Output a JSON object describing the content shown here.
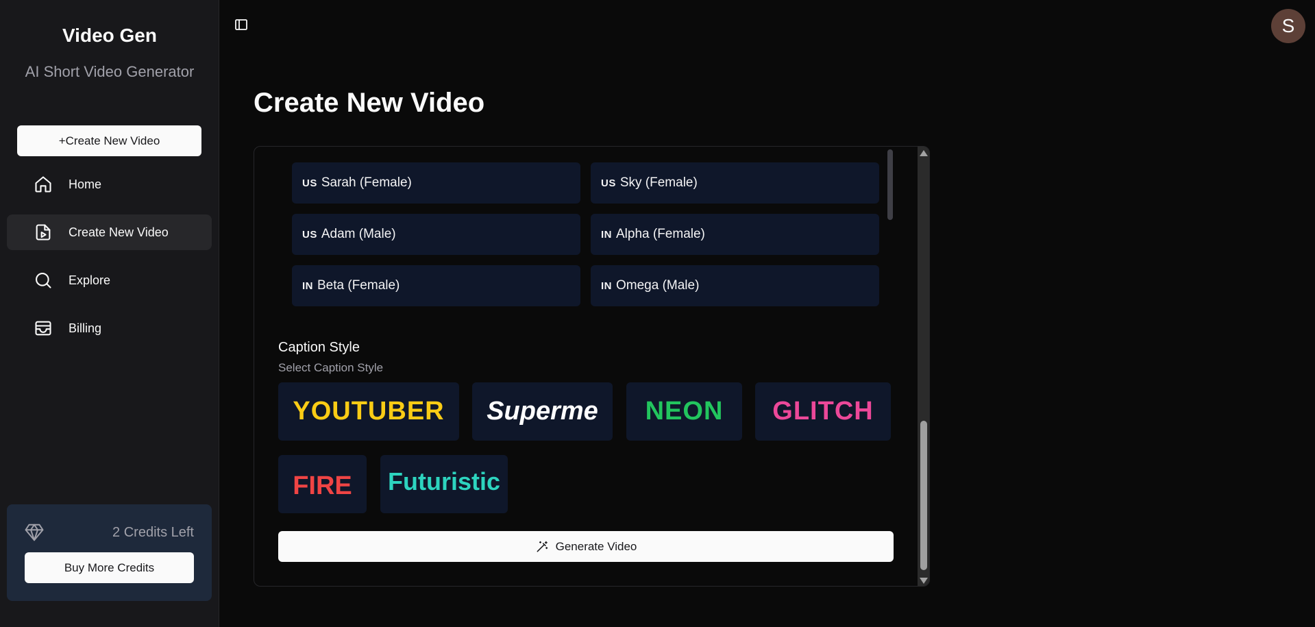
{
  "sidebar": {
    "brand_title": "Video Gen",
    "brand_subtitle": "AI Short Video Generator",
    "create_button": "+Create New Video",
    "items": [
      {
        "label": "Home",
        "icon": "home-icon",
        "active": false
      },
      {
        "label": "Create New Video",
        "icon": "file-video-icon",
        "active": true
      },
      {
        "label": "Explore",
        "icon": "search-icon",
        "active": false
      },
      {
        "label": "Billing",
        "icon": "wallet-icon",
        "active": false
      }
    ],
    "credits_text": "2 Credits Left",
    "buy_button": "Buy More Credits"
  },
  "header": {
    "avatar_initial": "S",
    "avatar_color": "#5d4037"
  },
  "main": {
    "title": "Create New Video",
    "voices": [
      {
        "flag": "US",
        "label": "Sarah (Female)"
      },
      {
        "flag": "US",
        "label": "Sky (Female)"
      },
      {
        "flag": "US",
        "label": "Adam (Male)"
      },
      {
        "flag": "IN",
        "label": "Alpha (Female)"
      },
      {
        "flag": "IN",
        "label": "Beta (Female)"
      },
      {
        "flag": "IN",
        "label": "Omega (Male)"
      }
    ],
    "caption_title": "Caption Style",
    "caption_subtitle": "Select Caption Style",
    "caption_styles": [
      {
        "label": "YOUTUBER",
        "color": "#facc15"
      },
      {
        "label": "Superme",
        "color": "#ffffff"
      },
      {
        "label": "NEON",
        "color": "#22c55e"
      },
      {
        "label": "GLITCH",
        "color": "#ec4899"
      },
      {
        "label": "FIRE",
        "color": "#ef4444"
      },
      {
        "label": "Futuristic",
        "color": "#2dd4bf"
      }
    ],
    "generate_button": "Generate Video"
  },
  "colors": {
    "background": "#0a0a0a",
    "sidebar": "#18181b",
    "card": "#0f172a",
    "credits_card": "#1e293b"
  }
}
